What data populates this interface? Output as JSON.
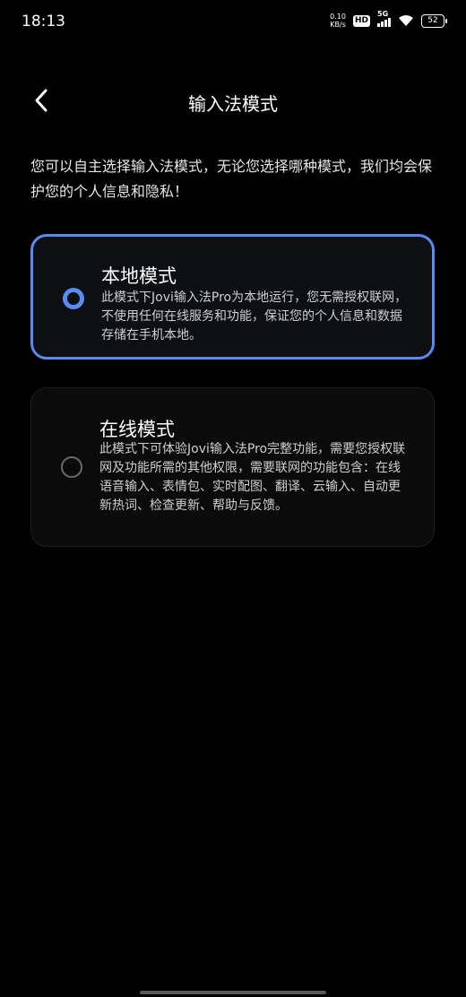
{
  "status_bar": {
    "time": "18:13",
    "net_speed_value": "0.10",
    "net_speed_unit": "KB/s",
    "hd_label": "HD",
    "network_label": "5G",
    "battery": "52"
  },
  "header": {
    "title": "输入法模式",
    "back_icon": "chevron-left-icon"
  },
  "intro": "您可以自主选择输入法模式，无论您选择哪种模式，我们均会保护您的个人信息和隐私！",
  "options": [
    {
      "title": "本地模式",
      "description": "此模式下Jovi输入法Pro为本地运行，您无需授权联网，不使用任何在线服务和功能，保证您的个人信息和数据存储在手机本地。",
      "selected": true
    },
    {
      "title": "在线模式",
      "description": "此模式下可体验Jovi输入法Pro完整功能，需要您授权联网及功能所需的其他权限，需要联网的功能包含：在线语音输入、表情包、实时配图、翻译、云输入、自动更新热词、检查更新、帮助与反馈。",
      "selected": false
    }
  ],
  "colors": {
    "background": "#000000",
    "accent": "#5b8af0",
    "text_primary": "#ffffff",
    "text_secondary": "#cfcfcf"
  }
}
